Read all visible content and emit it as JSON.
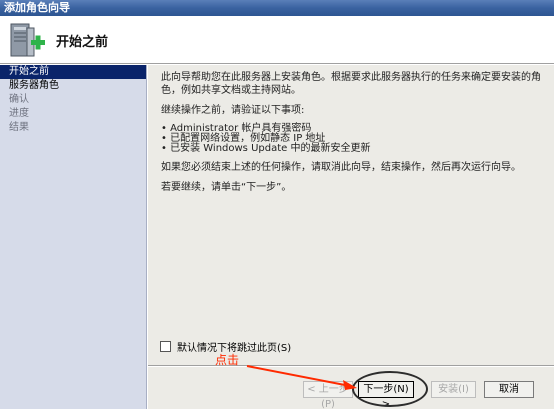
{
  "window": {
    "title": "添加角色向导"
  },
  "header": {
    "title": "开始之前"
  },
  "sidebar": {
    "items": [
      {
        "label": "开始之前",
        "state": "active"
      },
      {
        "label": "服务器角色",
        "state": "enabled"
      },
      {
        "label": "确认",
        "state": "disabled"
      },
      {
        "label": "进度",
        "state": "disabled"
      },
      {
        "label": "结果",
        "state": "disabled"
      }
    ]
  },
  "content": {
    "intro": "此向导帮助您在此服务器上安装角色。根据要求此服务器执行的任务来确定要安装的角色，例如共享文档或主持网站。",
    "prereq_heading": "继续操作之前，请验证以下事项:",
    "bullets": [
      "Administrator 帐户具有强密码",
      "已配置网络设置，例如静态 IP 地址",
      "已安装 Windows Update 中的最新安全更新"
    ],
    "cancel_note": "如果您必须结束上述的任何操作，请取消此向导，结束操作，然后再次运行向导。",
    "continue_note": "若要继续，请单击“下一步”。"
  },
  "skip_checkbox": {
    "label": "默认情况下将跳过此页(S)",
    "checked": false
  },
  "buttons": {
    "back": "< 上一步(P)",
    "next": "下一步(N) >",
    "install": "安装(I)",
    "cancel": "取消"
  },
  "annotation": {
    "text": "点击",
    "color": "#ff2a00"
  }
}
